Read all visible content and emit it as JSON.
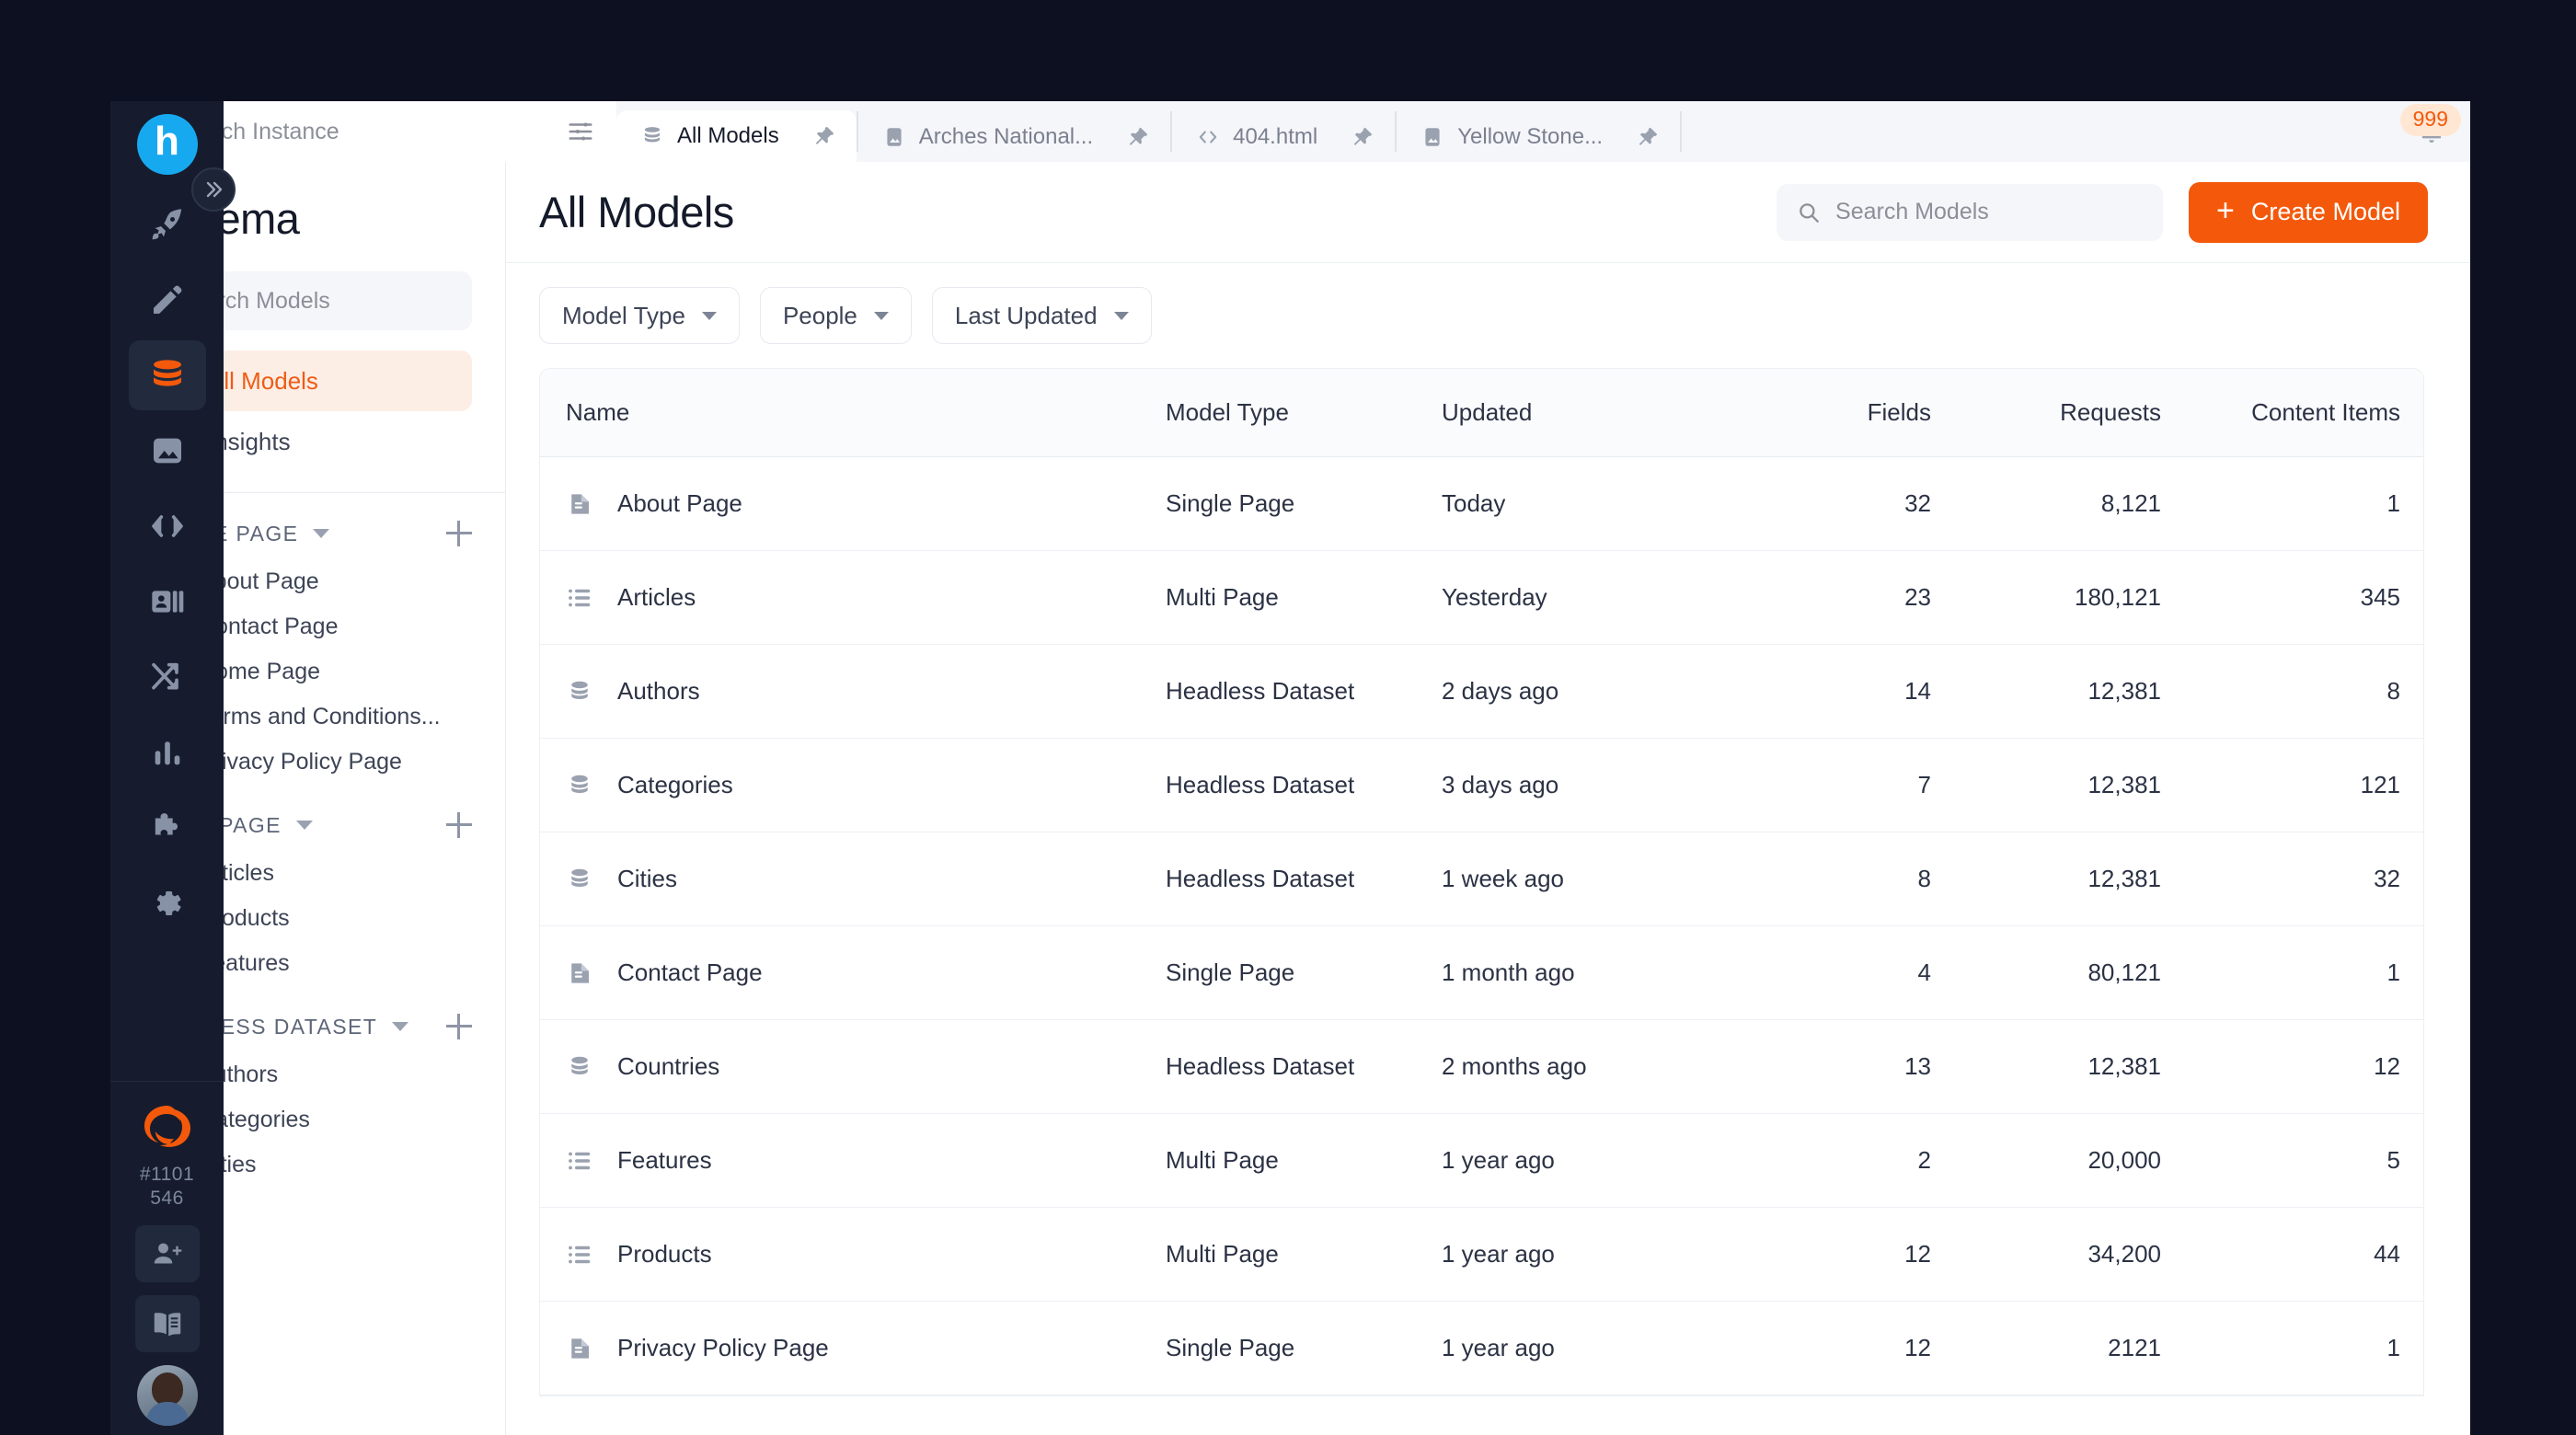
{
  "colors": {
    "accent": "#f4590b",
    "rail": "#161c2e",
    "page_bg": "#0d1020",
    "badge_bg": "#ffe7d4"
  },
  "topbar": {
    "search_instance": {
      "value": "",
      "placeholder": "Search Instance"
    },
    "filter_icon": "sliders-icon",
    "tabs": [
      {
        "label": "All Models",
        "icon": "database-icon",
        "active": true,
        "pinned": true
      },
      {
        "label": "Arches National...",
        "icon": "image-icon",
        "active": false,
        "pinned": true
      },
      {
        "label": "404.html",
        "icon": "code-icon",
        "active": false,
        "pinned": true
      },
      {
        "label": "Yellow Stone...",
        "icon": "image-icon",
        "active": false,
        "pinned": true
      }
    ],
    "notifications": {
      "icon": "bell-icon",
      "count": "999"
    }
  },
  "rail": {
    "logo": "h",
    "items": [
      {
        "name": "rocket-icon",
        "active": false
      },
      {
        "name": "pencil-icon",
        "active": false
      },
      {
        "name": "database-icon",
        "active": true
      },
      {
        "name": "media-icon",
        "active": false
      },
      {
        "name": "code-icon",
        "active": false
      },
      {
        "name": "contacts-icon",
        "active": false
      },
      {
        "name": "shuffle-icon",
        "active": false
      },
      {
        "name": "analytics-icon",
        "active": false
      },
      {
        "name": "puzzle-icon",
        "active": false
      },
      {
        "name": "gear-icon",
        "active": false
      }
    ],
    "instance_id": "#1101\n546",
    "instance_id_line1": "#1101",
    "instance_id_line2": "546",
    "bottom_items": [
      {
        "name": "add-user-icon"
      },
      {
        "name": "docs-icon"
      }
    ],
    "avatar": "user-avatar"
  },
  "expand_button": {
    "icon": "double-chevron-right-icon"
  },
  "sidebar": {
    "title": "Schema",
    "search": {
      "value": "",
      "placeholder": "Search Models"
    },
    "nav": [
      {
        "label": "All Models",
        "icon": "sitemap-icon",
        "active": true
      },
      {
        "label": "Insights",
        "icon": "insights-icon",
        "active": false
      }
    ],
    "groups": [
      {
        "title": "SINGLE PAGE",
        "items": [
          {
            "label": "About Page",
            "icon": "document-icon"
          },
          {
            "label": "Contact Page",
            "icon": "document-icon"
          },
          {
            "label": "Home Page",
            "icon": "document-icon"
          },
          {
            "label": "Terms and Conditions...",
            "icon": "document-icon"
          },
          {
            "label": "Privacy Policy Page",
            "icon": "document-icon"
          }
        ]
      },
      {
        "title": "MULTI PAGE",
        "items": [
          {
            "label": "Articles",
            "icon": "list-icon"
          },
          {
            "label": "Products",
            "icon": "list-icon"
          },
          {
            "label": "Features",
            "icon": "list-icon"
          }
        ]
      },
      {
        "title": "HEADLESS DATASET",
        "items": [
          {
            "label": "Authors",
            "icon": "grid-icon"
          },
          {
            "label": "Categories",
            "icon": "grid-icon"
          },
          {
            "label": "Cities",
            "icon": "grid-icon"
          }
        ]
      }
    ]
  },
  "main": {
    "page_title": "All Models",
    "search": {
      "value": "",
      "placeholder": "Search Models"
    },
    "create_button": {
      "label": "Create Model",
      "icon": "plus-icon"
    },
    "filters": [
      {
        "label": "Model Type"
      },
      {
        "label": "People"
      },
      {
        "label": "Last Updated"
      }
    ],
    "table": {
      "columns": [
        "Name",
        "Model Type",
        "Updated",
        "Fields",
        "Requests",
        "Content Items"
      ],
      "rows": [
        {
          "icon": "document-icon",
          "name": "About Page",
          "type": "Single Page",
          "updated": "Today",
          "fields": "32",
          "requests": "8,121",
          "items": "1"
        },
        {
          "icon": "list-icon",
          "name": "Articles",
          "type": "Multi Page",
          "updated": "Yesterday",
          "fields": "23",
          "requests": "180,121",
          "items": "345"
        },
        {
          "icon": "database-icon",
          "name": "Authors",
          "type": "Headless Dataset",
          "updated": "2 days ago",
          "fields": "14",
          "requests": "12,381",
          "items": "8"
        },
        {
          "icon": "database-icon",
          "name": "Categories",
          "type": "Headless Dataset",
          "updated": "3 days ago",
          "fields": "7",
          "requests": "12,381",
          "items": "121"
        },
        {
          "icon": "database-icon",
          "name": "Cities",
          "type": "Headless Dataset",
          "updated": "1 week ago",
          "fields": "8",
          "requests": "12,381",
          "items": "32"
        },
        {
          "icon": "document-icon",
          "name": "Contact Page",
          "type": "Single Page",
          "updated": "1 month ago",
          "fields": "4",
          "requests": "80,121",
          "items": "1"
        },
        {
          "icon": "database-icon",
          "name": "Countries",
          "type": "Headless Dataset",
          "updated": "2 months ago",
          "fields": "13",
          "requests": "12,381",
          "items": "12"
        },
        {
          "icon": "list-icon",
          "name": "Features",
          "type": "Multi Page",
          "updated": "1 year ago",
          "fields": "2",
          "requests": "20,000",
          "items": "5"
        },
        {
          "icon": "list-icon",
          "name": "Products",
          "type": "Multi Page",
          "updated": "1 year ago",
          "fields": "12",
          "requests": "34,200",
          "items": "44"
        },
        {
          "icon": "document-icon",
          "name": "Privacy Policy Page",
          "type": "Single Page",
          "updated": "1 year ago",
          "fields": "12",
          "requests": "2121",
          "items": "1"
        }
      ]
    }
  }
}
